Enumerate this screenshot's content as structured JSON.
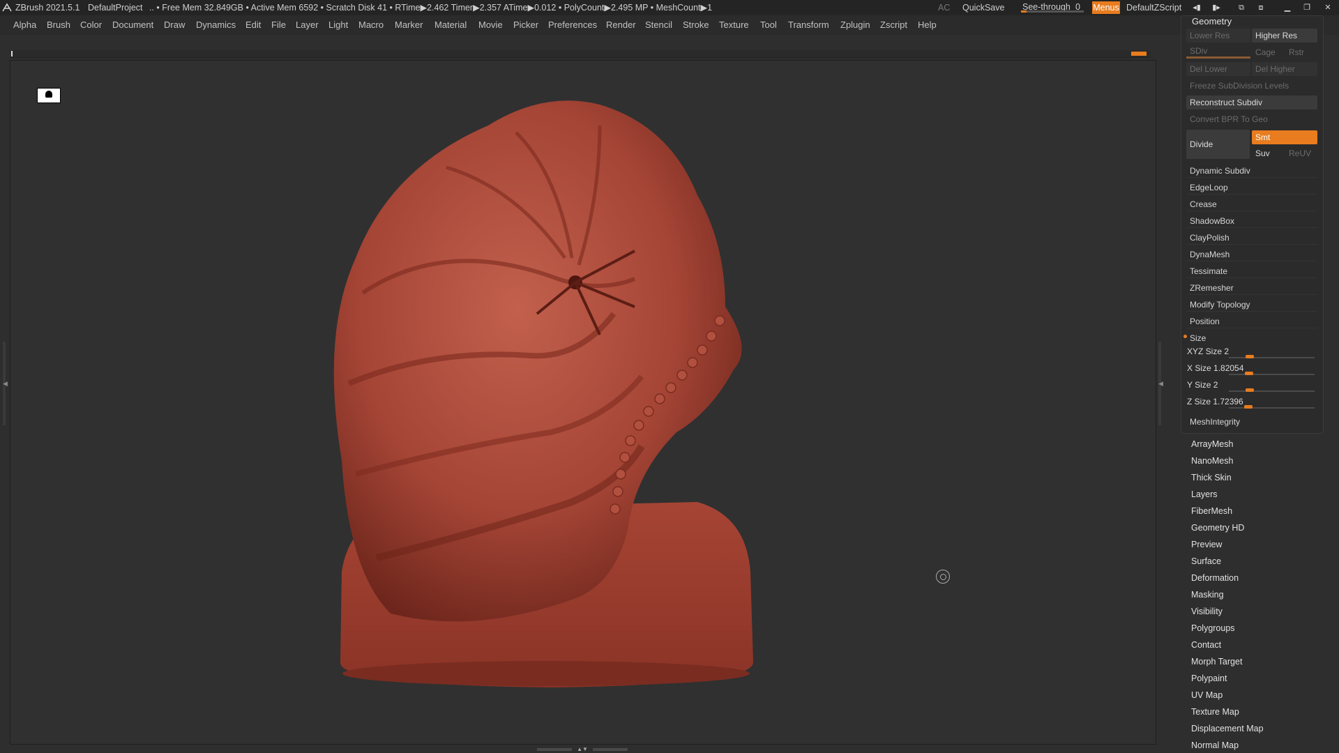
{
  "titlebar": {
    "app": "ZBrush 2021.5.1",
    "project": "DefaultProject",
    "stats": ".. • Free Mem 32.849GB • Active Mem 6592 • Scratch Disk 41 • RTime▶2.462 Timer▶2.357 ATime▶0.012 • PolyCount▶2.495 MP • MeshCount▶1",
    "ac": "AC",
    "quicksave": "QuickSave",
    "see_through_label": "See-through",
    "see_through_value": "0",
    "see_through_level": 0,
    "menus": "Menus",
    "zscript": "DefaultZScript"
  },
  "menubar": [
    "Alpha",
    "Brush",
    "Color",
    "Document",
    "Draw",
    "Dynamics",
    "Edit",
    "File",
    "Layer",
    "Light",
    "Macro",
    "Marker",
    "Material",
    "Movie",
    "Picker",
    "Preferences",
    "Render",
    "Stencil",
    "Stroke",
    "Texture",
    "Tool",
    "Transform",
    "Zplugin",
    "Zscript",
    "Help"
  ],
  "palette": {
    "title": "Geometry",
    "lower_res": "Lower Res",
    "higher_res": "Higher Res",
    "sdiv": "SDiv",
    "cage": "Cage",
    "rstr": "Rstr",
    "del_lower": "Del Lower",
    "del_higher": "Del Higher",
    "freeze": "Freeze SubDivision Levels",
    "reconstruct": "Reconstruct Subdiv",
    "convert": "Convert BPR To Geo",
    "divide": "Divide",
    "smt": "Smt",
    "suv": "Suv",
    "reuv": "ReUV",
    "rows": [
      "Dynamic Subdiv",
      "EdgeLoop",
      "Crease",
      "ShadowBox",
      "ClayPolish",
      "DynaMesh",
      "Tessimate",
      "ZRemesher",
      "Modify Topology",
      "Position"
    ],
    "size_header": "Size",
    "sliders": [
      {
        "label": "XYZ Size 2"
      },
      {
        "label": "X Size 1.82054"
      },
      {
        "label": "Y Size 2"
      },
      {
        "label": "Z Size 1.72396"
      }
    ],
    "mesh_integrity": "MeshIntegrity"
  },
  "subpalettes": [
    "ArrayMesh",
    "NanoMesh",
    "Thick Skin",
    "Layers",
    "FiberMesh",
    "Geometry HD",
    "Preview",
    "Surface",
    "Deformation",
    "Masking",
    "Visibility",
    "Polygroups",
    "Contact",
    "Morph Target",
    "Polypaint",
    "UV Map",
    "Texture Map",
    "Displacement Map",
    "Normal Map"
  ],
  "colors": {
    "accent": "#e87c1e",
    "model": "#a54536"
  }
}
